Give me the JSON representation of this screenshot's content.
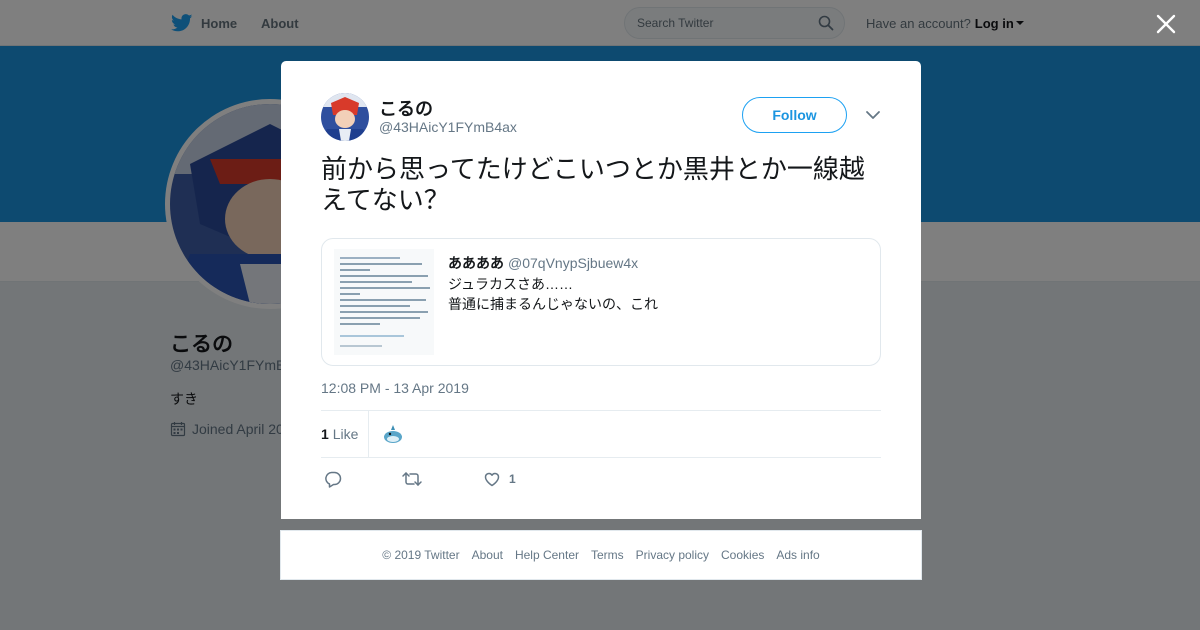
{
  "topbar": {
    "home_label": "Home",
    "about_label": "About",
    "search_placeholder": "Search Twitter",
    "account_prompt": "Have an account?",
    "login_label": "Log in"
  },
  "profile": {
    "name": "こるの",
    "handle": "@43HAicY1FYmB",
    "bio": "すき",
    "joined": "Joined April 20"
  },
  "tweet": {
    "author_name": "こるの",
    "author_handle": "@43HAicY1FYmB4ax",
    "follow_label": "Follow",
    "text": "前から思ってたけどこいつとか黒井とか一線越えてない？",
    "quote": {
      "name": "ああああ",
      "handle": "@07qVnypSjbuew4x",
      "line1": "ジュラカスさあ……",
      "line2": "普通に捕まるんじゃないの、これ"
    },
    "timestamp": "12:08 PM - 13 Apr 2019",
    "like_count": "1",
    "like_label": "Like",
    "action_like_count": "1"
  },
  "footer": {
    "links": [
      "© 2019 Twitter",
      "About",
      "Help Center",
      "Terms",
      "Privacy policy",
      "Cookies",
      "Ads info"
    ]
  },
  "colors": {
    "brand_blue": "#1da1f2",
    "banner": "#1b95e0",
    "overlay": "rgba(0,0,0,0.5)"
  },
  "icons": [
    "twitter-bird-icon",
    "search-icon",
    "close-icon",
    "chevron-down-icon",
    "calendar-icon",
    "reply-icon",
    "retweet-icon",
    "heart-icon"
  ]
}
